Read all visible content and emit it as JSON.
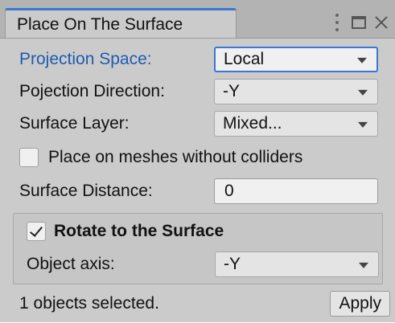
{
  "window": {
    "tab_title": "Place On The Surface"
  },
  "fields": {
    "projection_space": {
      "label": "Projection Space:",
      "value": "Local"
    },
    "projection_direction": {
      "label": "Pojection Direction:",
      "value": "-Y"
    },
    "surface_layer": {
      "label": "Surface Layer:",
      "value": "Mixed..."
    },
    "place_on_meshes": {
      "label": "Place on meshes without colliders",
      "checked": false
    },
    "surface_distance": {
      "label": "Surface Distance:",
      "value": "0"
    }
  },
  "rotate_group": {
    "toggle": {
      "label": "Rotate to the Surface",
      "checked": true
    },
    "object_axis": {
      "label": "Object axis:",
      "value": "-Y"
    }
  },
  "status": {
    "text": "1 objects selected.",
    "apply_label": "Apply"
  },
  "icons": {
    "menu": "kebab-menu-icon",
    "maximize": "maximize-icon",
    "close": "close-icon",
    "dropdown": "chevron-down-icon",
    "check": "checkmark-icon"
  },
  "colors": {
    "accent": "#3a78d4",
    "active_label": "#1e5bb0",
    "panel_bg": "#cbcbcb"
  }
}
